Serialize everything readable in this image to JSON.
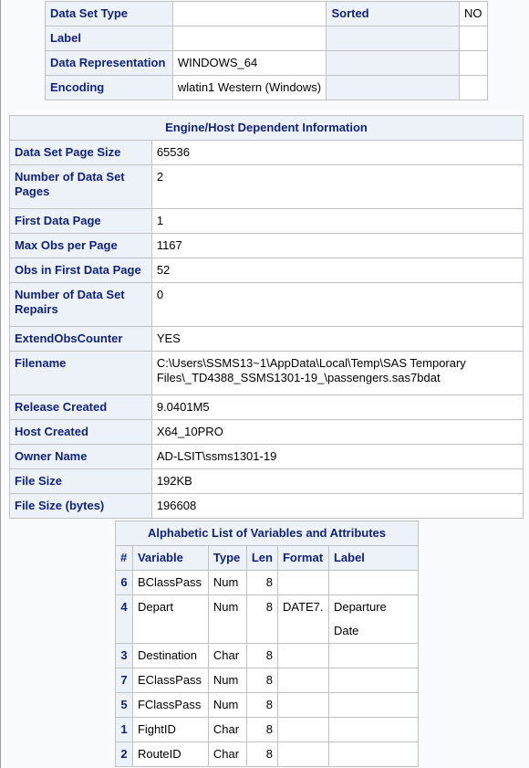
{
  "attributes": {
    "rows": [
      {
        "label": "Data Set Type",
        "value": "",
        "label2": "Sorted",
        "value2": "NO"
      },
      {
        "label": "Label",
        "value": "",
        "label2": "",
        "value2": ""
      },
      {
        "label": "Data Representation",
        "value": "WINDOWS_64",
        "label2": "",
        "value2": ""
      },
      {
        "label": "Encoding",
        "value": "wlatin1 Western (Windows)",
        "label2": "",
        "value2": ""
      }
    ]
  },
  "engine": {
    "title": "Engine/Host Dependent Information",
    "rows": [
      {
        "label": "Data Set Page Size",
        "value": "65536"
      },
      {
        "label": "Number of Data Set Pages",
        "value": "2"
      },
      {
        "label": "First Data Page",
        "value": "1"
      },
      {
        "label": "Max Obs per Page",
        "value": "1167"
      },
      {
        "label": "Obs in First Data Page",
        "value": "52"
      },
      {
        "label": "Number of Data Set Repairs",
        "value": "0"
      },
      {
        "label": "ExtendObsCounter",
        "value": "YES"
      },
      {
        "label": "Filename",
        "value": "C:\\Users\\SSMS13~1\\AppData\\Local\\Temp\\SAS Temporary Files\\_TD4388_SSMS1301-19_\\passengers.sas7bdat"
      },
      {
        "label": "Release Created",
        "value": "9.0401M5"
      },
      {
        "label": "Host Created",
        "value": "X64_10PRO"
      },
      {
        "label": "Owner Name",
        "value": "AD-LSIT\\ssms1301-19"
      },
      {
        "label": "File Size",
        "value": "192KB"
      },
      {
        "label": "File Size (bytes)",
        "value": "196608"
      }
    ]
  },
  "variables": {
    "title": "Alphabetic List of Variables and Attributes",
    "headers": [
      "#",
      "Variable",
      "Type",
      "Len",
      "Format",
      "Label"
    ],
    "rows": [
      {
        "num": "6",
        "variable": "BClassPass",
        "type": "Num",
        "len": "8",
        "format": "",
        "label": ""
      },
      {
        "num": "4",
        "variable": "Depart",
        "type": "Num",
        "len": "8",
        "format": "DATE7.",
        "label": "Departure Date"
      },
      {
        "num": "3",
        "variable": "Destination",
        "type": "Char",
        "len": "8",
        "format": "",
        "label": ""
      },
      {
        "num": "7",
        "variable": "EClassPass",
        "type": "Num",
        "len": "8",
        "format": "",
        "label": ""
      },
      {
        "num": "5",
        "variable": "FClassPass",
        "type": "Num",
        "len": "8",
        "format": "",
        "label": ""
      },
      {
        "num": "1",
        "variable": "FightID",
        "type": "Char",
        "len": "8",
        "format": "",
        "label": ""
      },
      {
        "num": "2",
        "variable": "RouteID",
        "type": "Char",
        "len": "8",
        "format": "",
        "label": ""
      }
    ]
  }
}
